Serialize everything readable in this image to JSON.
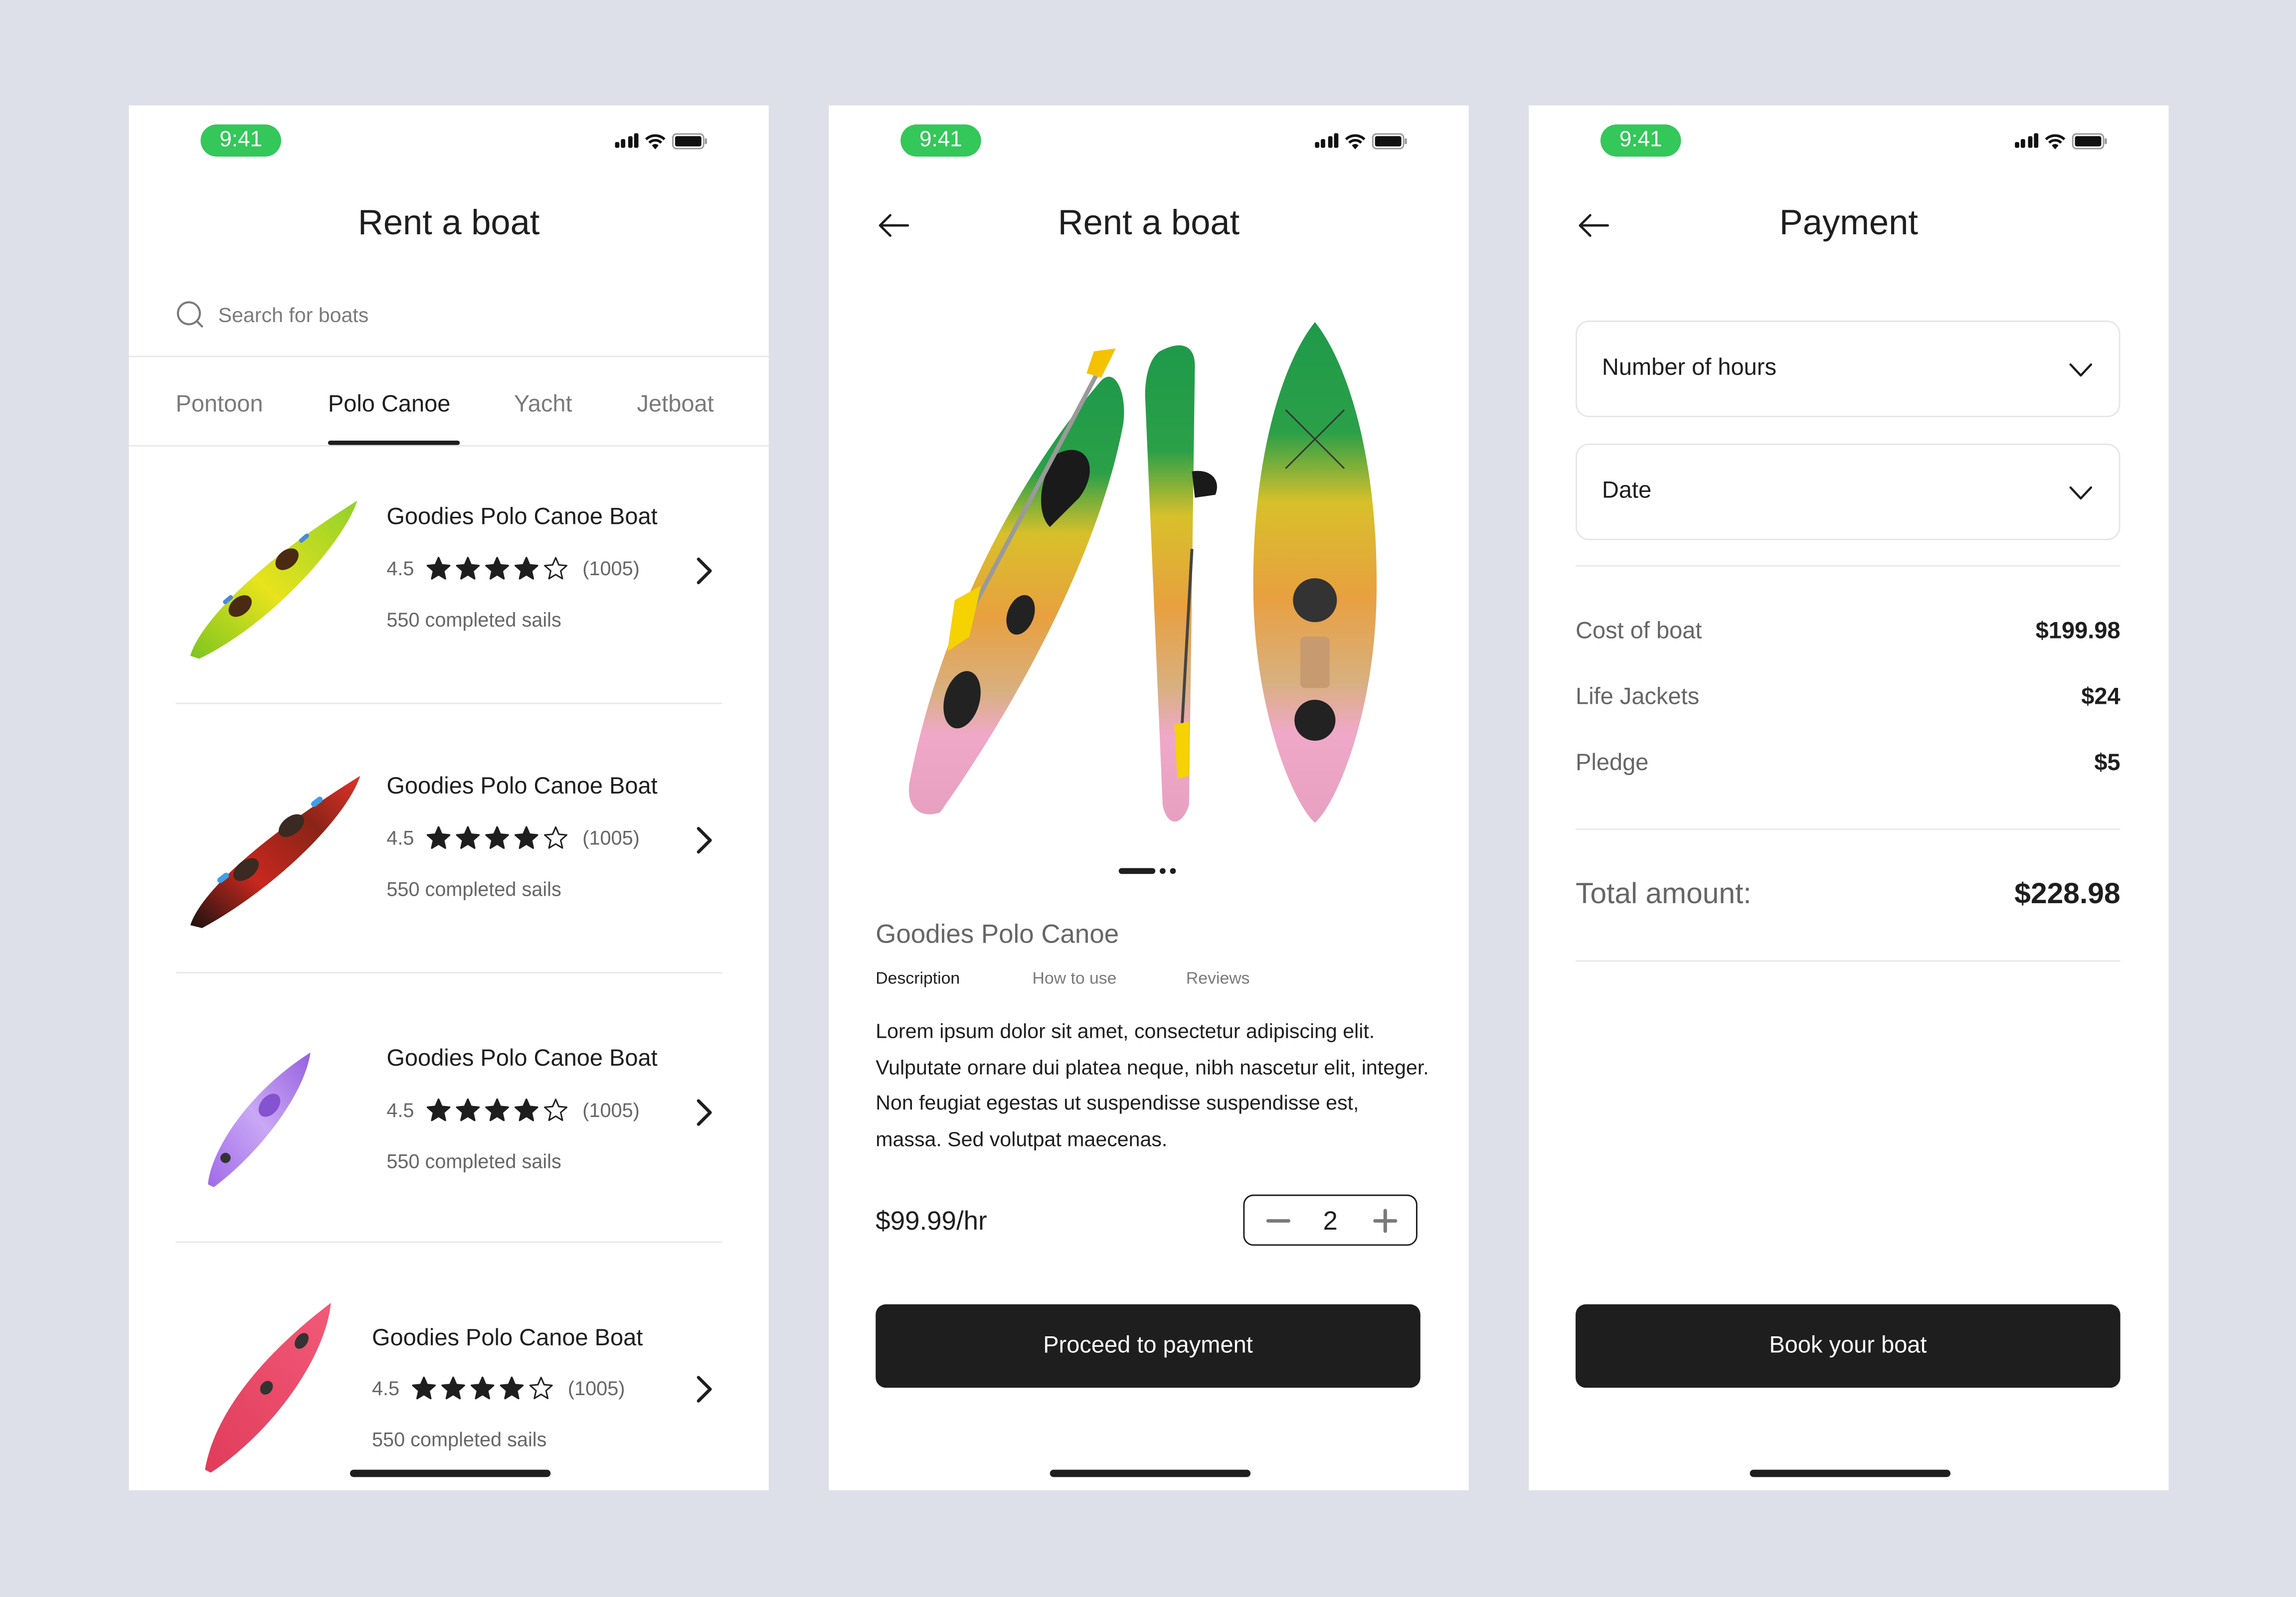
{
  "status_bar": {
    "time": "9:41"
  },
  "screens": {
    "list": {
      "title": "Rent a boat",
      "search": {
        "placeholder": "Search for boats",
        "value": ""
      },
      "tabs": [
        {
          "label": "Pontoon",
          "active": false
        },
        {
          "label": "Polo Canoe",
          "active": true
        },
        {
          "label": "Yacht",
          "active": false
        },
        {
          "label": "Jetboat",
          "active": false
        }
      ],
      "items": [
        {
          "name": "Goodies Polo Canoe Boat",
          "rating": "4.5",
          "stars_filled": 4,
          "stars_total": 5,
          "reviews": "(1005)",
          "sails": "550 completed sails",
          "image": "green-yellow-kayak"
        },
        {
          "name": "Goodies Polo Canoe Boat",
          "rating": "4.5",
          "stars_filled": 4,
          "stars_total": 5,
          "reviews": "(1005)",
          "sails": "550 completed sails",
          "image": "red-black-kayak"
        },
        {
          "name": "Goodies Polo Canoe Boat",
          "rating": "4.5",
          "stars_filled": 4,
          "stars_total": 5,
          "reviews": "(1005)",
          "sails": "550 completed sails",
          "image": "purple-kayak"
        },
        {
          "name": "Goodies Polo Canoe Boat",
          "rating": "4.5",
          "stars_filled": 4,
          "stars_total": 5,
          "reviews": "(1005)",
          "sails": "550 completed sails",
          "image": "pink-kayak"
        }
      ]
    },
    "detail": {
      "title": "Rent a boat",
      "gallery": {
        "image": "green-orange-pink-kayak-three-views",
        "pages": 3,
        "current_page": 1
      },
      "product_name": "Goodies Polo Canoe",
      "tabs": [
        {
          "label": "Description",
          "active": true
        },
        {
          "label": "How to use",
          "active": false
        },
        {
          "label": "Reviews",
          "active": false
        }
      ],
      "description": "Lorem ipsum dolor sit amet, consectetur adipiscing elit. Vulputate ornare dui platea neque, nibh nascetur elit, integer. Non feugiat egestas ut suspendisse suspendisse est, massa. Sed volutpat maecenas.",
      "price": "$99.99/hr",
      "quantity": "2",
      "cta": "Proceed to payment"
    },
    "payment": {
      "title": "Payment",
      "selects": [
        {
          "label": "Number of hours"
        },
        {
          "label": "Date"
        }
      ],
      "costs": [
        {
          "label": "Cost of boat",
          "value": "$199.98"
        },
        {
          "label": "Life Jackets",
          "value": "$24"
        },
        {
          "label": "Pledge",
          "value": "$5"
        }
      ],
      "total_label": "Total amount:",
      "total_value": "$228.98",
      "cta": "Book your boat"
    }
  },
  "colors": {
    "background": "#dde0e8",
    "status_green": "#34c759",
    "primary_dark": "#1e1e1e",
    "muted_text": "#666666"
  }
}
